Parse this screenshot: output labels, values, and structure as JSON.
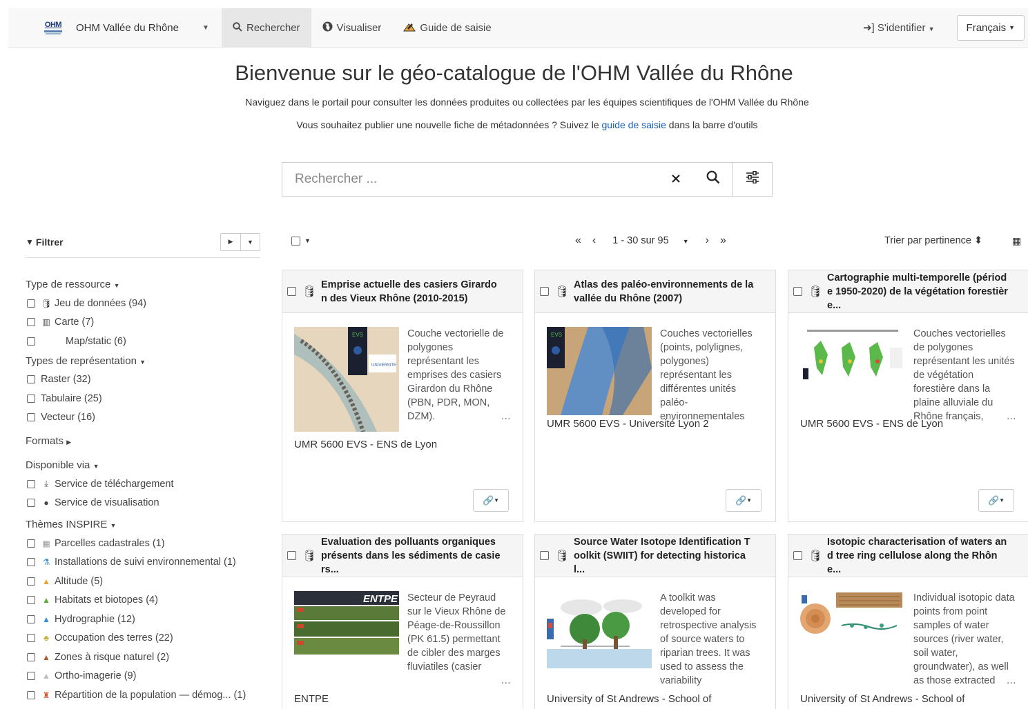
{
  "navbar": {
    "brand_logo_text": "OHM",
    "brand_name": "OHM Vallée du Rhône",
    "search_label": "Rechercher",
    "visualize_label": "Visualiser",
    "guide_label": "Guide de saisie",
    "login_label": "S'identifier",
    "language_label": "Français"
  },
  "header": {
    "title": "Bienvenue sur le géo-catalogue de l'OHM Vallée du Rhône",
    "subtitle": "Naviguez dans le portail pour consulter les données produites ou collectées par les équipes scientifiques de l'OHM Vallée du Rhône",
    "subtitle2_before": "Vous souhaitez publier une nouvelle fiche de métadonnées ? Suivez le ",
    "subtitle2_link": "guide de saisie",
    "subtitle2_after": " dans la barre d'outils"
  },
  "search": {
    "placeholder": "Rechercher ..."
  },
  "sidebar": {
    "filter_title": "Filtrer",
    "groups": {
      "type_ressource": {
        "title": "Type de ressource",
        "items": [
          "Jeu de données (94)",
          "Carte (7)",
          "Map/static (6)"
        ]
      },
      "types_representation": {
        "title": "Types de représentation",
        "items": [
          "Raster (32)",
          "Tabulaire (25)",
          "Vecteur (16)"
        ]
      },
      "formats": {
        "title": "Formats"
      },
      "disponible_via": {
        "title": "Disponible via",
        "items": [
          "Service de téléchargement",
          "Service de visualisation"
        ]
      },
      "themes": {
        "title": "Thèmes INSPIRE",
        "items": [
          "Parcelles cadastrales (1)",
          "Installations de suivi environnemental (1)",
          "Altitude (5)",
          "Habitats et biotopes (4)",
          "Hydrographie (12)",
          "Occupation des terres (22)",
          "Zones à risque naturel (2)",
          "Ortho-imagerie (9)",
          "Répartition de la population — démog... (1)"
        ]
      }
    }
  },
  "results": {
    "pager": "1 - 30 sur 95",
    "sort_label": "Trier par pertinence",
    "cards": [
      {
        "title": "Emprise actuelle des casiers Girardon des Vieux Rhône (2010-2015)",
        "description": "Couche vectorielle de polygones représentant les emprises des casiers Girardon du Rhône (PBN, PDR, MON, DZM).",
        "organisation": "UMR 5600 EVS - ENS de Lyon"
      },
      {
        "title": "Atlas des paléo-environnements de la vallée du Rhône (2007)",
        "description": "Couches vectorielles (points, polylignes, polygones) représentant les différentes unités paléo-environnementales",
        "organisation": "UMR 5600 EVS - Université Lyon 2"
      },
      {
        "title": "Cartographie multi-temporelle (période 1950-2020) de la végétation forestière...",
        "description": "Couches vectorielles de polygones représentant les unités de végétation forestière dans la plaine alluviale du Rhône français,",
        "organisation": "UMR 5600 EVS - ENS de Lyon"
      },
      {
        "title": "Evaluation des polluants organiques présents dans les sédiments de casiers...",
        "description": "Secteur de Peyraud sur le Vieux Rhône de Péage-de-Roussillon (PK 61.5) permettant de cibler des marges fluviatiles (casier",
        "organisation": "ENTPE",
        "thumb_text": "ENTPE"
      },
      {
        "title": "Source Water Isotope Identification Toolkit (SWIIT) for detecting historical...",
        "description": "A toolkit was developed for retrospective analysis of source waters to riparian trees. It was used to assess the variability",
        "organisation": "University of St Andrews - School of"
      },
      {
        "title": "Isotopic characterisation of waters and tree ring cellulose along the Rhône...",
        "description": "Individual isotopic data points from point samples of water sources (river water, soil water, groundwater), as well as those extracted",
        "organisation": "University of St Andrews - School of"
      }
    ]
  }
}
